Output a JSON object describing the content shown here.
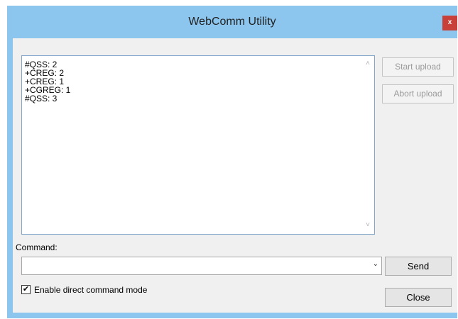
{
  "window": {
    "title": "WebComm Utility",
    "close_glyph": "x"
  },
  "log": {
    "lines": [
      "#QSS: 2",
      "+CREG: 2",
      "+CREG: 1",
      "+CGREG: 1",
      "#QSS: 3"
    ],
    "scroll_up_icon": "˄",
    "scroll_down_icon": "˅"
  },
  "side_buttons": {
    "start_upload": "Start upload",
    "abort_upload": "Abort upload"
  },
  "command": {
    "label": "Command:",
    "value": "",
    "dropdown_icon": "⌄",
    "send_label": "Send"
  },
  "options": {
    "direct_mode_label": "Enable direct command mode",
    "direct_mode_checked": true,
    "check_glyph": "✔"
  },
  "footer": {
    "close_label": "Close"
  }
}
